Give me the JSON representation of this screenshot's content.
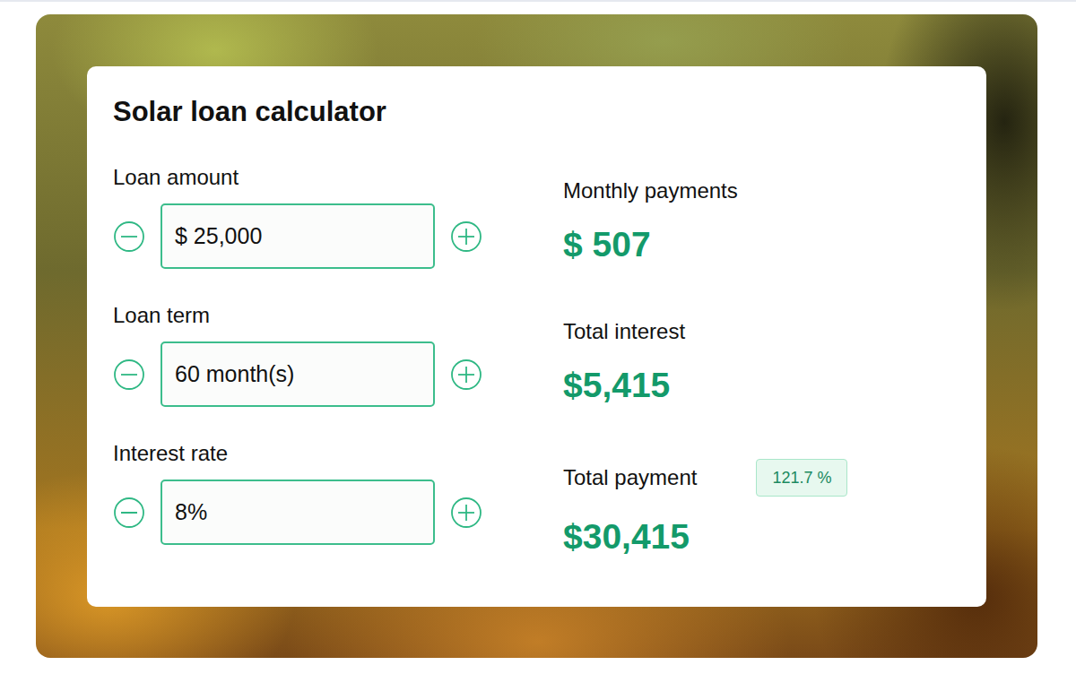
{
  "title": "Solar loan calculator",
  "inputs": [
    {
      "label": "Loan amount",
      "value": "$ 25,000"
    },
    {
      "label": "Loan term",
      "value": "60 month(s)"
    },
    {
      "label": "Interest rate",
      "value": "8%"
    }
  ],
  "results": [
    {
      "label": "Monthly payments",
      "value": "$ 507"
    },
    {
      "label": "Total interest",
      "value": "$5,415"
    },
    {
      "label": "Total payment",
      "value": "$30,415",
      "badge": "121.7 %"
    }
  ]
}
